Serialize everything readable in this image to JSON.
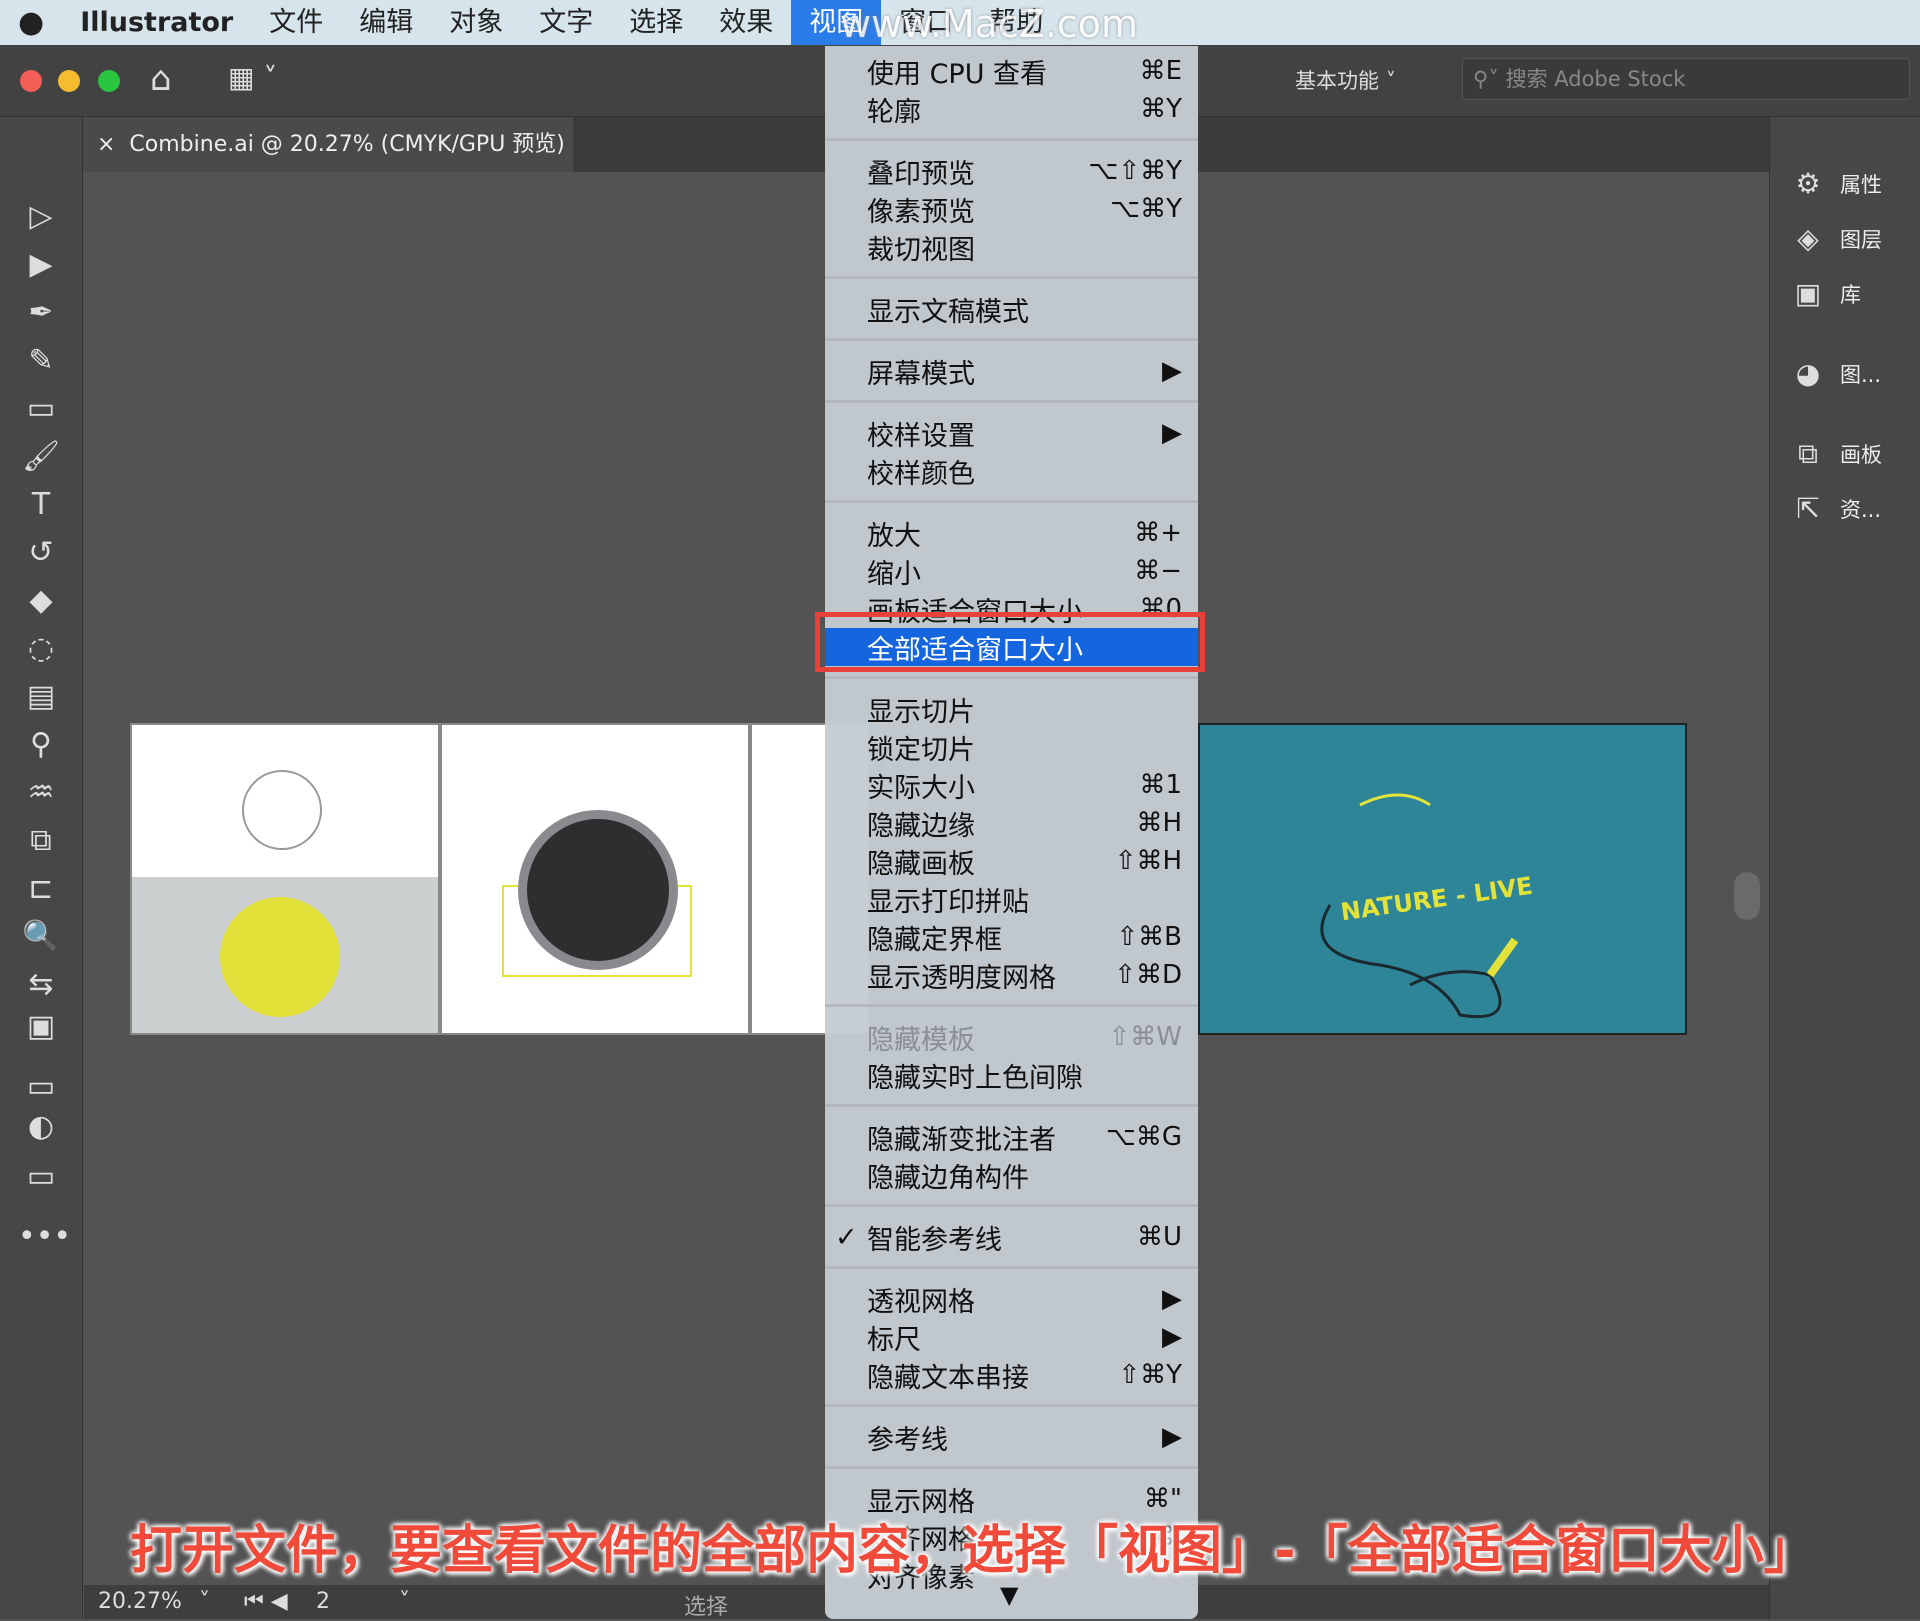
{
  "menubar": {
    "items": [
      "Illustrator",
      "文件",
      "编辑",
      "对象",
      "文字",
      "选择",
      "效果",
      "视图",
      "窗口",
      "帮助"
    ],
    "active": "视图",
    "watermark": "www.MacZ.com"
  },
  "toolbar": {
    "workspace": "基本功能",
    "search_placeholder": "搜索 Adobe Stock"
  },
  "document_tab": {
    "title": "Combine.ai @ 20.27% (CMYK/GPU 预览)"
  },
  "right_panel": {
    "items": [
      "属性",
      "图层",
      "库",
      "图...",
      "画板",
      "资..."
    ]
  },
  "status": {
    "zoom": "20.27%",
    "artboard": "2",
    "tool": "选择"
  },
  "artwork": {
    "text": "NATURE - LIVE",
    "bg_color": "#2e8597",
    "accent": "#e3e23a"
  },
  "view_menu": {
    "items": [
      {
        "label": "使用 CPU 查看",
        "shortcut": "⌘E"
      },
      {
        "label": "轮廓",
        "shortcut": "⌘Y"
      },
      {
        "sep": true
      },
      {
        "label": "叠印预览",
        "shortcut": "⌥⇧⌘Y"
      },
      {
        "label": "像素预览",
        "shortcut": "⌥⌘Y"
      },
      {
        "label": "裁切视图",
        "shortcut": ""
      },
      {
        "sep": true
      },
      {
        "label": "显示文稿模式",
        "shortcut": ""
      },
      {
        "sep": true
      },
      {
        "label": "屏幕模式",
        "shortcut": "▶"
      },
      {
        "sep": true
      },
      {
        "label": "校样设置",
        "shortcut": "▶"
      },
      {
        "label": "校样颜色",
        "shortcut": ""
      },
      {
        "sep": true
      },
      {
        "label": "放大",
        "shortcut": "⌘+"
      },
      {
        "label": "缩小",
        "shortcut": "⌘−"
      },
      {
        "label": "画板适合窗口大小",
        "shortcut": "⌘0"
      },
      {
        "label": "全部适合窗口大小",
        "shortcut": "",
        "highlighted": true
      },
      {
        "sep": true
      },
      {
        "label": "显示切片",
        "shortcut": ""
      },
      {
        "label": "锁定切片",
        "shortcut": ""
      },
      {
        "label": "实际大小",
        "shortcut": "⌘1"
      },
      {
        "label": "隐藏边缘",
        "shortcut": "⌘H"
      },
      {
        "label": "隐藏画板",
        "shortcut": "⇧⌘H"
      },
      {
        "label": "显示打印拼贴",
        "shortcut": ""
      },
      {
        "label": "隐藏定界框",
        "shortcut": "⇧⌘B"
      },
      {
        "label": "显示透明度网格",
        "shortcut": "⇧⌘D"
      },
      {
        "sep": true
      },
      {
        "label": "隐藏模板",
        "shortcut": "⇧⌘W",
        "disabled": true
      },
      {
        "label": "隐藏实时上色间隙",
        "shortcut": ""
      },
      {
        "sep": true
      },
      {
        "label": "隐藏渐变批注者",
        "shortcut": "⌥⌘G"
      },
      {
        "label": "隐藏边角构件",
        "shortcut": ""
      },
      {
        "sep": true
      },
      {
        "label": "智能参考线",
        "shortcut": "⌘U",
        "checked": true
      },
      {
        "sep": true
      },
      {
        "label": "透视网格",
        "shortcut": "▶"
      },
      {
        "label": "标尺",
        "shortcut": "▶"
      },
      {
        "label": "隐藏文本串接",
        "shortcut": "⇧⌘Y"
      },
      {
        "sep": true
      },
      {
        "label": "参考线",
        "shortcut": "▶"
      },
      {
        "sep": true
      },
      {
        "label": "显示网格",
        "shortcut": "⌘\""
      },
      {
        "label": "对齐网格",
        "shortcut": "⌘'"
      },
      {
        "label": "对齐像素",
        "shortcut": ""
      }
    ],
    "scroll_arrow": "▼"
  },
  "caption": "打开文件，要查看文件的全部内容，选择「视图」-「全部适合窗口大小」"
}
